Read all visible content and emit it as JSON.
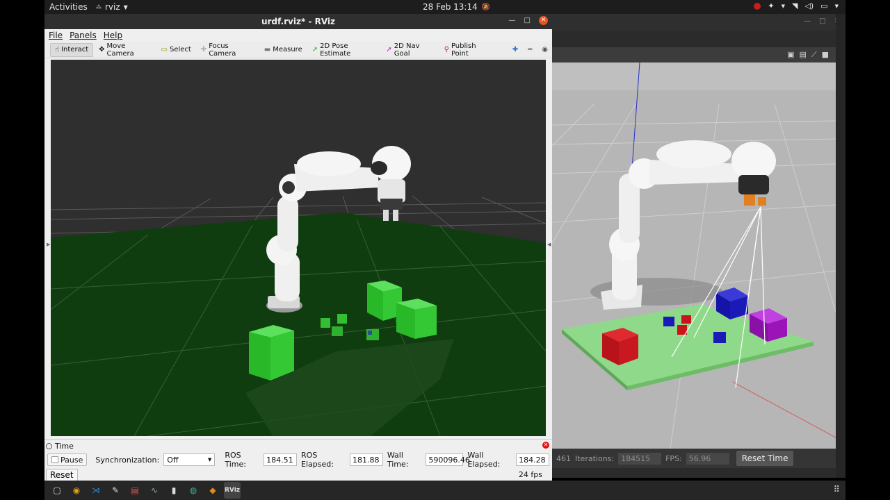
{
  "topbar": {
    "activities": "Activities",
    "app_name": "rviz",
    "app_icon": "rviz-glyph",
    "clock": "28 Feb  13:14",
    "tray_icons": [
      "record-indicator-icon",
      "accessibility-icon",
      "network-wifi-icon",
      "volume-icon",
      "battery-icon",
      "system-menu-icon"
    ]
  },
  "rviz": {
    "title": "urdf.rviz* - RViz",
    "menu": {
      "file": "File",
      "panels": "Panels",
      "help": "Help"
    },
    "tools": [
      {
        "label": "Interact",
        "icon": "hand-icon"
      },
      {
        "label": "Move Camera",
        "icon": "move-icon"
      },
      {
        "label": "Select",
        "icon": "select-box-icon"
      },
      {
        "label": "Focus Camera",
        "icon": "focus-icon"
      },
      {
        "label": "Measure",
        "icon": "ruler-icon"
      },
      {
        "label": "2D Pose Estimate",
        "icon": "green-arrow-icon"
      },
      {
        "label": "2D Nav Goal",
        "icon": "magenta-arrow-icon"
      },
      {
        "label": "Publish Point",
        "icon": "pin-icon"
      }
    ],
    "time_panel": {
      "header": "Time",
      "pause_label": "Pause",
      "sync_label": "Synchronization:",
      "sync_value": "Off",
      "ros_time_label": "ROS Time:",
      "ros_time": "184.51",
      "ros_elapsed_label": "ROS Elapsed:",
      "ros_elapsed": "181.88",
      "wall_time_label": "Wall Time:",
      "wall_time": "590096.46",
      "wall_elapsed_label": "Wall Elapsed:",
      "wall_elapsed": "184.28",
      "reset_label": "Reset",
      "fps": "24 fps"
    },
    "colors": {
      "grid_floor": "#0e3a0e",
      "box_green": "#2fd42f",
      "background": "#2f2f2f"
    }
  },
  "gazebo": {
    "toolbar_icons": [
      "camera-icon",
      "record-icon",
      "plot-icon",
      "video-icon"
    ],
    "status": {
      "partial": "461",
      "iterations_label": "Iterations:",
      "iterations": "184515",
      "fps_label": "FPS:",
      "fps": "56.96",
      "reset_time": "Reset Time"
    },
    "colors": {
      "table": "#8fd98a",
      "red": "#c8141a",
      "blue": "#1a1ab8",
      "purple": "#9b14b8"
    }
  },
  "dock": {
    "apps": [
      "files-icon",
      "chrome-icon",
      "vscode-icon",
      "text-editor-icon",
      "document-viewer-icon",
      "system-monitor-icon",
      "terminal-icon",
      "globe-icon",
      "package-icon"
    ],
    "active_app": "RViz"
  }
}
